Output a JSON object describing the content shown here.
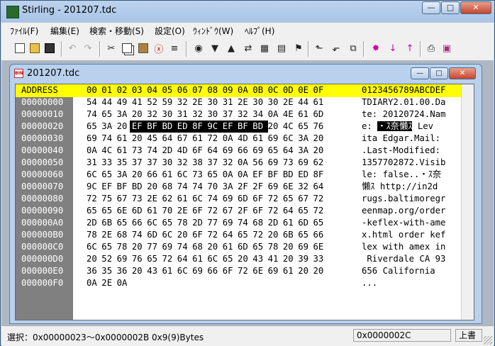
{
  "window": {
    "title": "Stirling - 201207.tdc"
  },
  "menu": [
    "ﾌｧｲﾙ(F)",
    "編集(E)",
    "検索・移動(S)",
    "設定(O)",
    "ｳｨﾝﾄﾞｳ(W)",
    "ﾍﾙﾌﾟ(H)"
  ],
  "toolbar_icons": [
    "new-file-icon",
    "open-folder-icon",
    "save-icon",
    "undo-icon",
    "redo-icon",
    "cut-icon",
    "copy-icon",
    "paste-icon",
    "delete-icon",
    "format-icon",
    "find-icon",
    "find-next-icon",
    "find-prev-icon",
    "find-replace-icon",
    "compare-icon",
    "compare-next-icon",
    "goto-icon",
    "block-start-icon",
    "block-end-icon",
    "block-select-icon",
    "mark-icon",
    "next-mark-icon",
    "prev-mark-icon",
    "print-icon",
    "help-book-icon"
  ],
  "document": {
    "title": "201207.tdc",
    "icon_label": "BIN"
  },
  "hex": {
    "header_address": "ADDRESS",
    "header_columns": [
      "00",
      "01",
      "02",
      "03",
      "04",
      "05",
      "06",
      "07",
      "08",
      "09",
      "0A",
      "0B",
      "0C",
      "0D",
      "0E",
      "0F"
    ],
    "header_ascii": "0123456789ABCDEF",
    "rows": [
      {
        "addr": "00000000",
        "bytes": [
          "54",
          "44",
          "49",
          "41",
          "52",
          "59",
          "32",
          "2E",
          "30",
          "31",
          "2E",
          "30",
          "30",
          "2E",
          "44",
          "61"
        ],
        "ascii": "TDIARY2.01.00.Da"
      },
      {
        "addr": "00000010",
        "bytes": [
          "74",
          "65",
          "3A",
          "20",
          "32",
          "30",
          "31",
          "32",
          "30",
          "37",
          "32",
          "34",
          "0A",
          "4E",
          "61",
          "6D"
        ],
        "ascii": "te: 20120724.Nam"
      },
      {
        "addr": "00000020",
        "bytes": [
          "65",
          "3A",
          "20",
          "EF",
          "BF",
          "BD",
          "ED",
          "8F",
          "9C",
          "EF",
          "BF",
          "BD",
          "20",
          "4C",
          "65",
          "76"
        ],
        "ascii": "e: ・ｽ奈懶ｽ Lev",
        "ascii_pre": "e: ",
        "ascii_sel": "・ｽ奈懶ｽ",
        "ascii_post": " Lev"
      },
      {
        "addr": "00000030",
        "bytes": [
          "69",
          "74",
          "61",
          "20",
          "45",
          "64",
          "67",
          "61",
          "72",
          "0A",
          "4D",
          "61",
          "69",
          "6C",
          "3A",
          "20"
        ],
        "ascii": "ita Edgar.Mail: "
      },
      {
        "addr": "00000040",
        "bytes": [
          "0A",
          "4C",
          "61",
          "73",
          "74",
          "2D",
          "4D",
          "6F",
          "64",
          "69",
          "66",
          "69",
          "65",
          "64",
          "3A",
          "20"
        ],
        "ascii": ".Last-Modified: "
      },
      {
        "addr": "00000050",
        "bytes": [
          "31",
          "33",
          "35",
          "37",
          "37",
          "30",
          "32",
          "38",
          "37",
          "32",
          "0A",
          "56",
          "69",
          "73",
          "69",
          "62"
        ],
        "ascii": "1357702872.Visib"
      },
      {
        "addr": "00000060",
        "bytes": [
          "6C",
          "65",
          "3A",
          "20",
          "66",
          "61",
          "6C",
          "73",
          "65",
          "0A",
          "0A",
          "EF",
          "BF",
          "BD",
          "ED",
          "8F"
        ],
        "ascii": "le: false..・ｽ奈"
      },
      {
        "addr": "00000070",
        "bytes": [
          "9C",
          "EF",
          "BF",
          "BD",
          "20",
          "68",
          "74",
          "74",
          "70",
          "3A",
          "2F",
          "2F",
          "69",
          "6E",
          "32",
          "64"
        ],
        "ascii": "懶ｽ http://in2d"
      },
      {
        "addr": "00000080",
        "bytes": [
          "72",
          "75",
          "67",
          "73",
          "2E",
          "62",
          "61",
          "6C",
          "74",
          "69",
          "6D",
          "6F",
          "72",
          "65",
          "67",
          "72"
        ],
        "ascii": "rugs.baltimoregr"
      },
      {
        "addr": "00000090",
        "bytes": [
          "65",
          "65",
          "6E",
          "6D",
          "61",
          "70",
          "2E",
          "6F",
          "72",
          "67",
          "2F",
          "6F",
          "72",
          "64",
          "65",
          "72"
        ],
        "ascii": "eenmap.org/order"
      },
      {
        "addr": "000000A0",
        "bytes": [
          "2D",
          "6B",
          "65",
          "66",
          "6C",
          "65",
          "78",
          "2D",
          "77",
          "69",
          "74",
          "68",
          "2D",
          "61",
          "6D",
          "65"
        ],
        "ascii": "-keflex-with-ame"
      },
      {
        "addr": "000000B0",
        "bytes": [
          "78",
          "2E",
          "68",
          "74",
          "6D",
          "6C",
          "20",
          "6F",
          "72",
          "64",
          "65",
          "72",
          "20",
          "6B",
          "65",
          "66"
        ],
        "ascii": "x.html order kef"
      },
      {
        "addr": "000000C0",
        "bytes": [
          "6C",
          "65",
          "78",
          "20",
          "77",
          "69",
          "74",
          "68",
          "20",
          "61",
          "6D",
          "65",
          "78",
          "20",
          "69",
          "6E"
        ],
        "ascii": "lex with amex in"
      },
      {
        "addr": "000000D0",
        "bytes": [
          "20",
          "52",
          "69",
          "76",
          "65",
          "72",
          "64",
          "61",
          "6C",
          "65",
          "20",
          "43",
          "41",
          "20",
          "39",
          "33"
        ],
        "ascii": " Riverdale CA 93"
      },
      {
        "addr": "000000E0",
        "bytes": [
          "36",
          "35",
          "36",
          "20",
          "43",
          "61",
          "6C",
          "69",
          "66",
          "6F",
          "72",
          "6E",
          "69",
          "61",
          "20",
          "20"
        ],
        "ascii": "656 California  "
      },
      {
        "addr": "000000F0",
        "bytes": [
          "0A",
          "2E",
          "0A",
          "",
          "",
          "",
          "",
          "",
          "",
          "",
          "",
          "",
          "",
          "",
          "",
          ""
        ],
        "ascii": "..."
      }
    ],
    "selection": {
      "row": 2,
      "from": 3,
      "to": 11
    }
  },
  "status": {
    "selection_text": "選択：0x00000023～0x0000002B  0x9(9)Bytes",
    "cursor": "0x0000002C",
    "mode": "上書"
  },
  "colors": {
    "header_bg": "#ffff00",
    "address_bg": "#808080",
    "selection_bg": "#000000"
  }
}
